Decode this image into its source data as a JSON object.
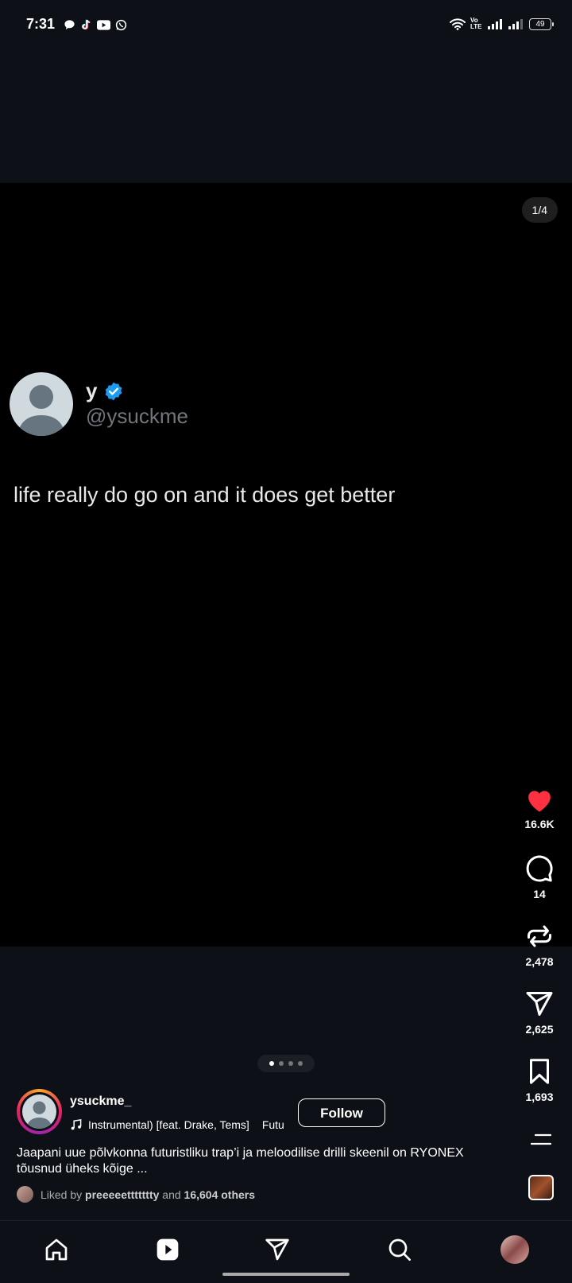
{
  "status": {
    "time": "7:31",
    "network": "Vo LTE",
    "battery": "49"
  },
  "media": {
    "page_counter": "1/4"
  },
  "tweet": {
    "name": "y",
    "handle": "@ysuckme",
    "text": "life really do go on and it does get better"
  },
  "actions": {
    "likes": "16.6K",
    "comments": "14",
    "reposts": "2,478",
    "shares": "2,625",
    "saves": "1,693"
  },
  "carousel": {
    "count": 4,
    "active": 1
  },
  "post": {
    "author": "ysuckme_",
    "music_primary": "Instrumental) [feat. Drake, Tems]",
    "music_secondary": "Futu",
    "follow_label": "Follow",
    "caption": "Jaapani uue põlvkonna futuristliku trap’i ja meloodilise drilli skeenil on RYONEX tõusnud üheks kõige ...",
    "liked_prefix": "Liked by",
    "liked_user": "preeeeettttttty",
    "liked_and": "and",
    "liked_others": "16,604 others"
  },
  "colors": {
    "like": "#ff3040",
    "verified": "#1d9bf0",
    "background": "#0d1117"
  },
  "icons": [
    "home-icon",
    "reels-icon",
    "send-icon",
    "search-icon",
    "profile-avatar"
  ]
}
